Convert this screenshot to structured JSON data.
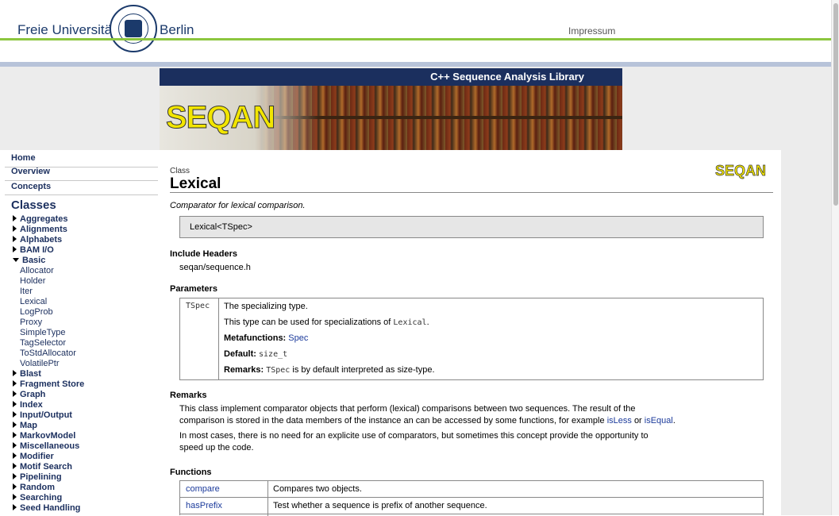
{
  "header": {
    "university_left": "Freie Universität",
    "university_right": "Berlin",
    "impressum": "Impressum"
  },
  "banner": {
    "title": "C++ Sequence Analysis Library",
    "logo_text": "SEQAN"
  },
  "sidebar": {
    "top_links": [
      "Home",
      "Overview",
      "Concepts"
    ],
    "classes_heading": "Classes",
    "categories_before": [
      "Aggregates",
      "Alignments",
      "Alphabets",
      "BAM I/O"
    ],
    "expanded_category": "Basic",
    "basic_items": [
      "Allocator",
      "Holder",
      "Iter",
      "Lexical",
      "LogProb",
      "Proxy",
      "SimpleType",
      "TagSelector",
      "ToStdAllocator",
      "VolatilePtr"
    ],
    "categories_after": [
      "Blast",
      "Fragment Store",
      "Graph",
      "Index",
      "Input/Output",
      "Map",
      "MarkovModel",
      "Miscellaneous",
      "Modifier",
      "Motif Search",
      "Pipelining",
      "Random",
      "Searching",
      "Seed Handling"
    ]
  },
  "content": {
    "kind": "Class",
    "title": "Lexical",
    "logo_text": "SEQAN",
    "summary": "Comparator for lexical comparison.",
    "signature": "Lexical<TSpec>",
    "include_heading": "Include Headers",
    "include_file": "seqan/sequence.h",
    "parameters_heading": "Parameters",
    "param": {
      "name": "TSpec",
      "desc1": "The specializing type.",
      "desc2_prefix": "This type can be used for specializations of",
      "desc2_code": "Lexical",
      "desc2_suffix": ".",
      "metafunctions_label": "Metafunctions:",
      "metafunctions_value": "Spec",
      "default_label": "Default:",
      "default_value": "size_t",
      "remarks_label": "Remarks:",
      "remarks_code": "TSpec",
      "remarks_text": "is by default interpreted as size-type."
    },
    "remarks_heading": "Remarks",
    "remarks_p1_line1": "This class implement comparator objects that perform (lexical) comparisons between two sequences. The result of the",
    "remarks_p1_line2_prefix": "comparison is stored in the data members of the instance an can be accessed by some functions, for example",
    "remarks_link1": "isLess",
    "remarks_or": "or",
    "remarks_link2": "isEqual",
    "remarks_p1_end": ".",
    "remarks_p2_line1": "In most cases, there is no need for an explicite use of comparators, but sometimes this concept provide the opportunity to",
    "remarks_p2_line2": "speed up the code.",
    "functions_heading": "Functions",
    "functions": [
      {
        "name": "compare",
        "desc": "Compares two objects."
      },
      {
        "name": "hasPrefix",
        "desc": "Test whether a sequence is prefix of another sequence."
      }
    ]
  }
}
